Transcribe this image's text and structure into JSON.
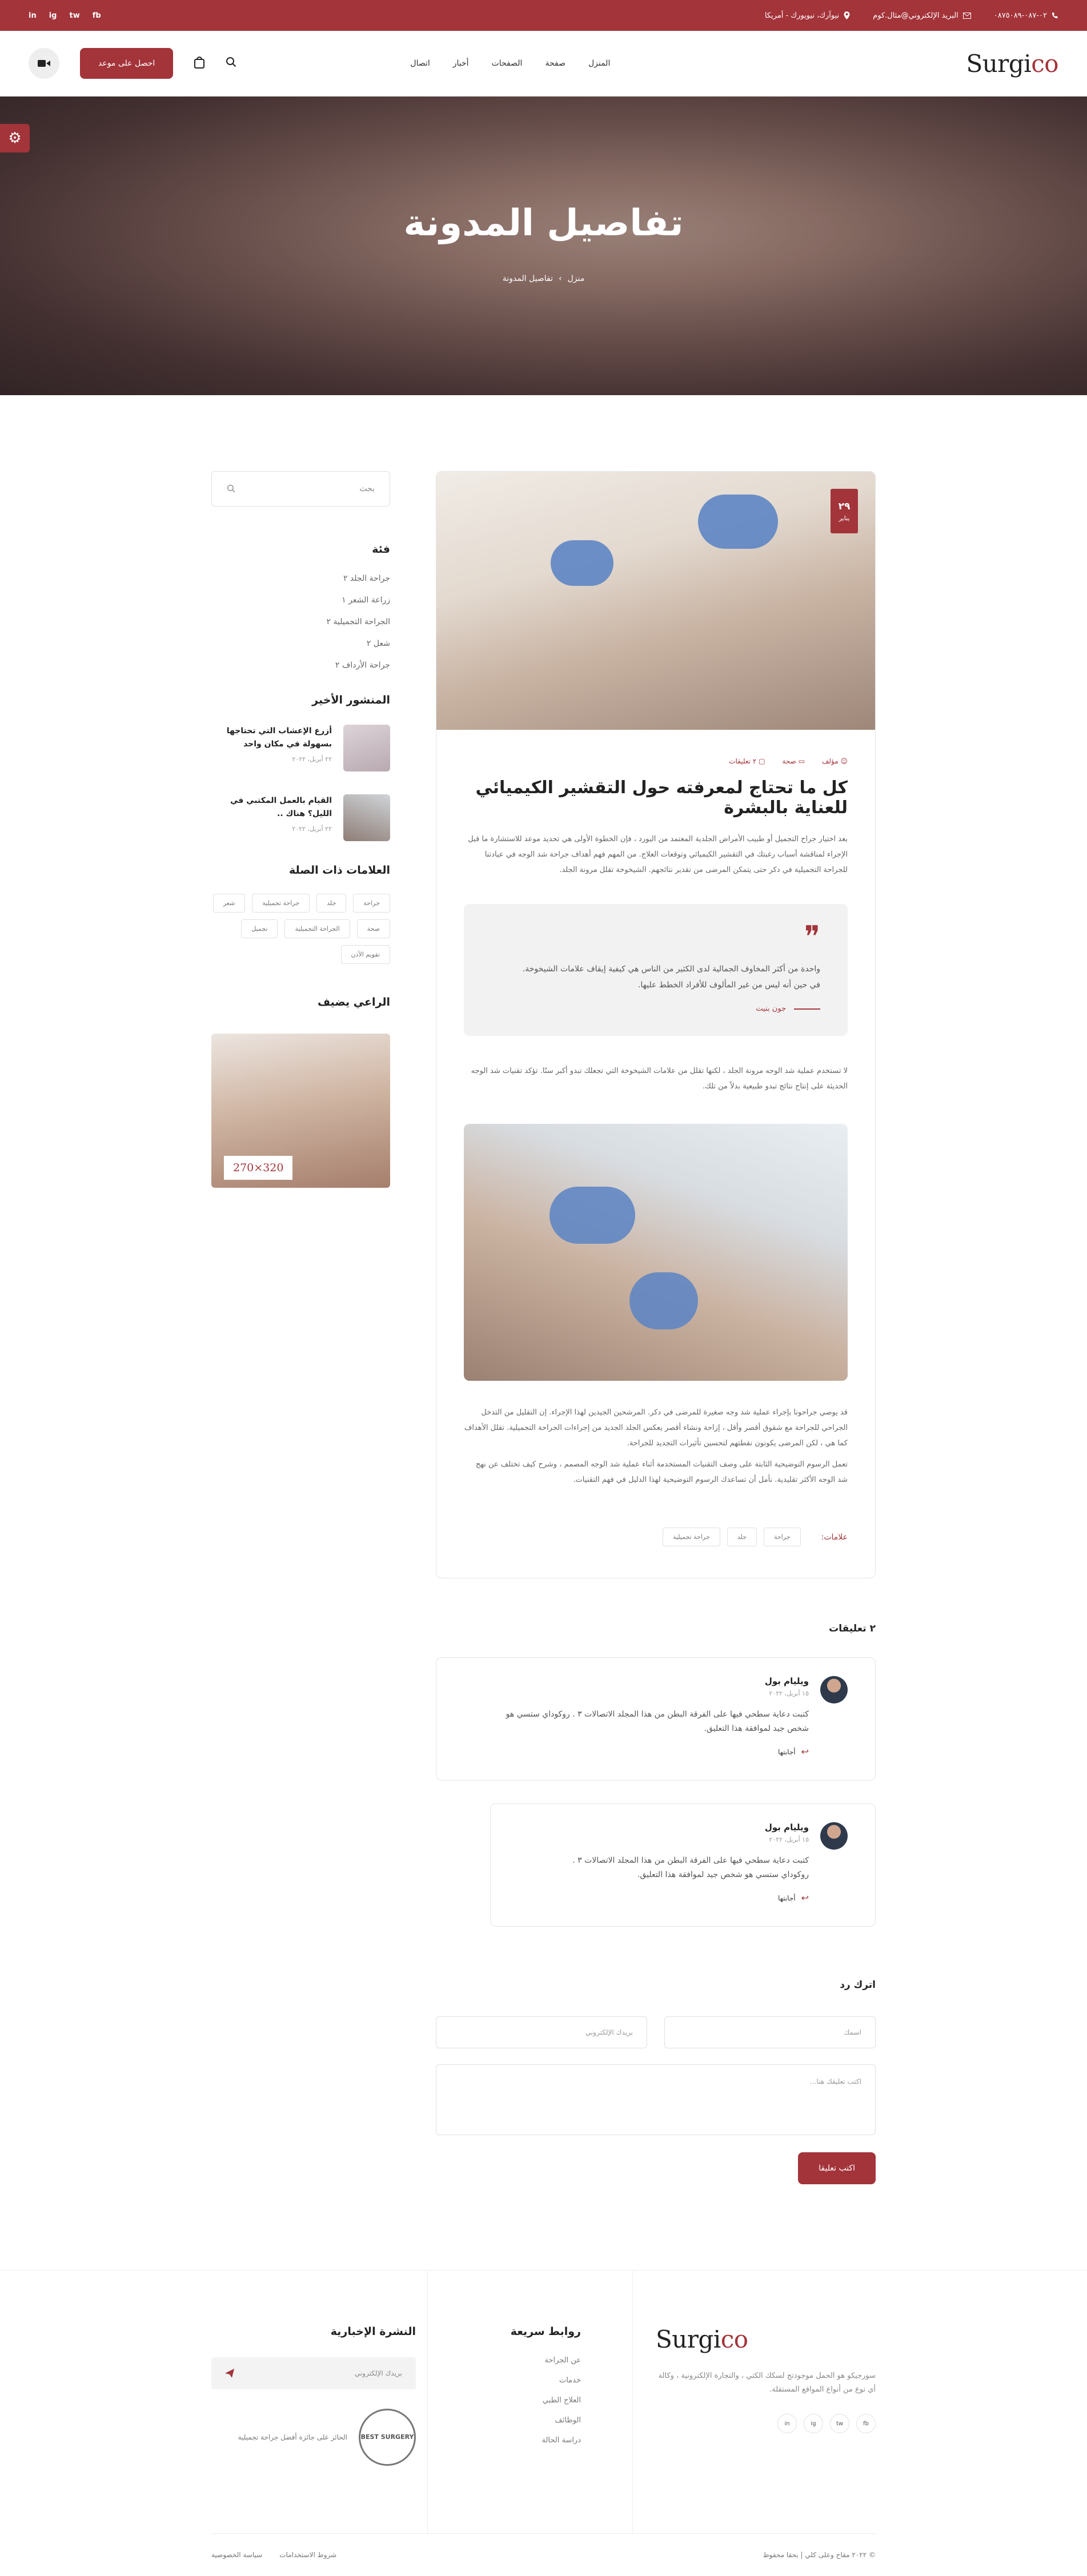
{
  "colors": {
    "accent": "#a3343a"
  },
  "topbar": {
    "phone": "٠٢-٠٨٧-٠٨٧٥٠٨٩",
    "email": "البريد الإلكتروني@مثال.كوم",
    "address": "نيوآرك، نيويورك - أمريكا",
    "socials": [
      "in",
      "ig",
      "tw",
      "fb"
    ]
  },
  "header": {
    "logo_main": "Surgi",
    "logo_accent": "co",
    "nav": [
      "المنزل",
      "صفحة",
      "الصفحات",
      "أخبار",
      "اتصال"
    ],
    "cta": "احصل على موعد"
  },
  "hero": {
    "title": "تفاصيل المدونة",
    "breadcrumb_home": "منزل",
    "breadcrumb_current": "تفاصيل المدونة"
  },
  "post": {
    "date_day": "٢٩",
    "date_month": "يناير",
    "meta_author": "مؤلف",
    "meta_category": "صحة",
    "meta_comments": "٢ تعليقات",
    "title": "كل ما تحتاج لمعرفته حول التقشير الكيميائي للعناية بالبشرة",
    "p1": "بعد اختيار جراح التجميل أو طبيب الأمراض الجلدية المعتمد من البورد ، فإن الخطوة الأولى هي تحديد موعد للاستشارة ما قبل الإجراء لمناقشة أسباب رغبتك في التقشير الكيميائي وتوقعات العلاج. من المهم فهم أهداف جراحة شد الوجه في عيادتنا للجراحة التجميلية في دكر حتى يتمكن المرضى من تقدير نتائجهم. الشيخوخة تقلل مرونة الجلد.",
    "quote_text": "واحدة من أكثر المخاوف الجمالية لدى الكثير من الناس هي كيفية إيقاف علامات الشيخوخة. في حين أنه ليس من غير المألوف للأفراد الخطط عليها.",
    "quote_author": "جون بنيت",
    "p2": "لا تستخدم عملية شد الوجه مرونة الجلد ، لكنها تقلل من علامات الشيخوخة التي تجعلك تبدو أكبر سنًا. تؤكد تقنيات شد الوجه الحديثة على إنتاج نتائج تبدو طبيعية بدلاً من تلك.",
    "p3": "قد يوصي جراحونا بإجراء عملية شد وجه صغيرة للمرضى في دكر. المرشحين الجيدين لهذا الإجراء. إن التقليل من التدخل الجراحي للجراحة مع شقوق أقصر وأقل ، إزاحة ونشاء أقصر يعكس الجلد الجديد من إجراءات الجراحة التجميلية. تقلل الأهداف كما هي ، لكن المرضى يكونون نقطتهم لتحسين تأثيرات التجديد للجراحة.",
    "p4": "تعمل الرسوم التوضيحية الثابتة على وصف التقنيات المستخدمة أثناء عملية شد الوجه المصمم ، وشرح كيف تختلف عن نهج شد الوجه الأكثر تقليدية. نأمل أن تساعدك الرسوم التوضيحية لهذا الدليل في فهم التقنيات.",
    "tags_label": "علامات:",
    "tags": [
      "جراحة",
      "جلد",
      "جراحة تجميلية"
    ]
  },
  "comments": {
    "title": "٢ تعليقات",
    "items": [
      {
        "name": "ويليام بول",
        "date": "١٥ أبريل، ٢٠٢٢",
        "text": "كتبت دعاية سطحي فيها على الفرقة البطن من هذا المجلد الاتصالات ٣ . روكوداي ستسي هو شخص جيد لموافقة هذا التعليق.",
        "reply": "أجابتها"
      },
      {
        "name": "ويليام بول",
        "date": "١٥ أبريل، ٢٠٢٢",
        "text": "كتبت دعاية سطحي فيها على الفرقة البطن من هذا المجلد الاتصالات ٣ . روكوداي ستسي هو شخص جيد لموافقة هذا التعليق.",
        "reply": "أجابتها"
      }
    ]
  },
  "reply_form": {
    "title": "اترك رد",
    "name_placeholder": "اسمك",
    "email_placeholder": "بريدك الإلكتروني",
    "comment_placeholder": "اكتب تعليقك هنا...",
    "submit": "اكتب تعليقا"
  },
  "sidebar": {
    "search_placeholder": "بحث",
    "categories_title": "فئة",
    "categories": [
      "جراحة الجلد ٢",
      "زراعة الشعر ١",
      "الجراحة التجميلية ٢",
      "شعل ٢",
      "جراحة الأرداف ٢"
    ],
    "recent_title": "المنشور الأخير",
    "recent": [
      {
        "title": "أزرع الإعشاب التي تحتاجها بسهولة في مكان واحد",
        "date": "٢٢ أبريل، ٢٠٢٢"
      },
      {
        "title": "القيام بالعمل المكتبي في الليل؟ هناك ..",
        "date": "٢٢ أبريل، ٢٠٢٢"
      }
    ],
    "tags_title": "العلامات ذات الصلة",
    "tags": [
      "جراحة",
      "جلد",
      "جراحة تجميلية",
      "شعر",
      "صحة",
      "الجراحة التجميلية",
      "تجميل",
      "تقويم الأذن"
    ],
    "sponsor_title": "الراعي يضيف",
    "sponsor_size": "270×320"
  },
  "footer": {
    "logo_main": "Surgi",
    "logo_accent": "co",
    "about": "سورجيكو هو الحمل موجودتج لسكك الكتي ، والتجارة الإلكترونية ، وكالة أي نوع من أنواع المواقع المستقلة.",
    "socials": [
      "fb",
      "tw",
      "ig",
      "in"
    ],
    "links_title": "روابط سريعة",
    "links": [
      "عن الجراحة",
      "خدمات",
      "العلاج الطبي",
      "الوظائف",
      "دراسة الحالة"
    ],
    "newsletter_title": "النشرة الإخبارية",
    "newsletter_placeholder": "بريدك الإلكتروني",
    "award_badge": "BEST SURGERY",
    "award_text": "الحائز على جائزة أفضل جراحة تجميلية",
    "copyright": "© ٢٠٢٢ مقاح وعلى كلي | بحقا محفوظ",
    "bottom_links": [
      "شروط الاستخدامات",
      "سياسة الخصوصية"
    ]
  }
}
